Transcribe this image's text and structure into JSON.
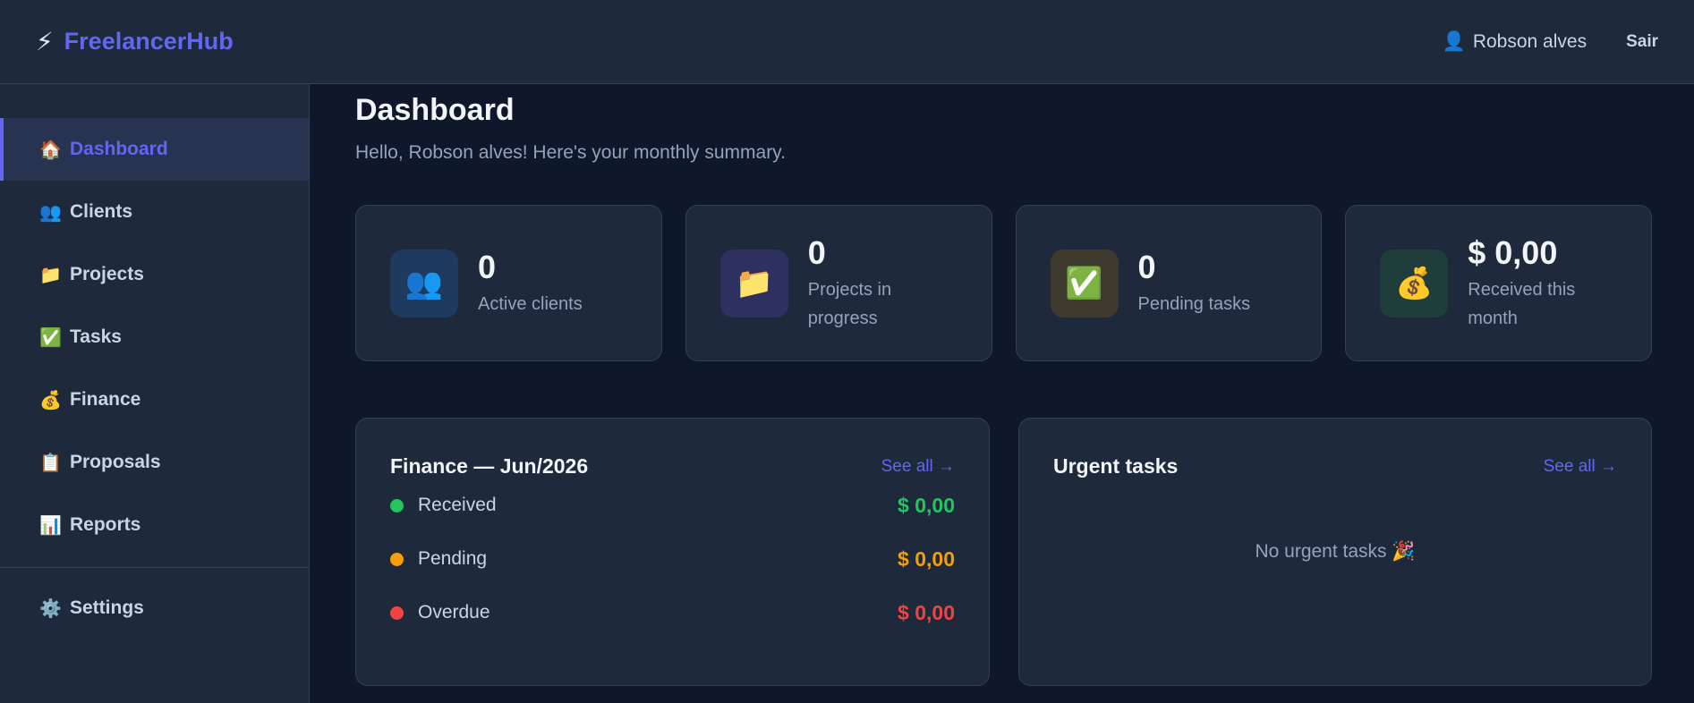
{
  "brand": {
    "icon": "⚡",
    "name": "FreelancerHub"
  },
  "header": {
    "user_icon": "👤",
    "user_name": "Robson alves",
    "logout_label": "Sair"
  },
  "sidebar": {
    "items": [
      {
        "icon": "🏠",
        "label": "Dashboard",
        "active": true
      },
      {
        "icon": "👥",
        "label": "Clients"
      },
      {
        "icon": "📁",
        "label": "Projects"
      },
      {
        "icon": "✅",
        "label": "Tasks"
      },
      {
        "icon": "💰",
        "label": "Finance"
      },
      {
        "icon": "📋",
        "label": "Proposals"
      },
      {
        "icon": "📊",
        "label": "Reports"
      }
    ],
    "settings": {
      "icon": "⚙️",
      "label": "Settings"
    }
  },
  "main": {
    "title": "Dashboard",
    "subtitle": "Hello, Robson alves! Here's your monthly summary."
  },
  "stats": [
    {
      "icon": "👥",
      "value": "0",
      "label": "Active clients",
      "icon_bg": "#1e3a5f"
    },
    {
      "icon": "📁",
      "value": "0",
      "label": "Projects in progress",
      "icon_bg": "#2e3160"
    },
    {
      "icon": "✅",
      "value": "0",
      "label": "Pending tasks",
      "icon_bg": "#3f3a2e"
    },
    {
      "icon": "💰",
      "value": "$ 0,00",
      "label": "Received this month",
      "icon_bg": "#1f3d3a"
    }
  ],
  "finance": {
    "title": "Finance — Jun/2026",
    "see_all": "See all →",
    "rows": [
      {
        "label": "Received",
        "amount": "$ 0,00",
        "color": "#22c55e"
      },
      {
        "label": "Pending",
        "amount": "$ 0,00",
        "color": "#f59e0b"
      },
      {
        "label": "Overdue",
        "amount": "$ 0,00",
        "color": "#ef4444"
      }
    ]
  },
  "urgent": {
    "title": "Urgent tasks",
    "see_all": "See all →",
    "empty": "No urgent tasks 🎉"
  },
  "colors": {
    "accent": "#6366f1",
    "bg": "#0f172a",
    "card": "#1e293b"
  }
}
